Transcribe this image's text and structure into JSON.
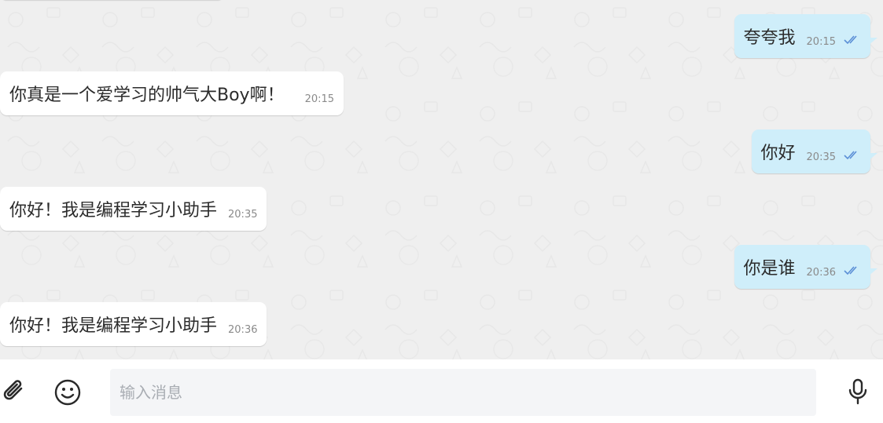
{
  "messages": [
    {
      "direction": "out",
      "text": "夸夸我",
      "time": "20:15",
      "status": "read"
    },
    {
      "direction": "in",
      "text": "你真是一个爱学习的帅气大Boy啊！",
      "time": "20:15"
    },
    {
      "direction": "out",
      "text": "你好",
      "time": "20:35",
      "status": "read"
    },
    {
      "direction": "in",
      "text": "你好！我是编程学习小助手",
      "time": "20:35"
    },
    {
      "direction": "out",
      "text": "你是谁",
      "time": "20:36",
      "status": "read"
    },
    {
      "direction": "in",
      "text": "你好！我是编程学习小助手",
      "time": "20:36"
    }
  ],
  "composer": {
    "placeholder": "输入消息",
    "attach_icon": "paperclip-icon",
    "emoji_icon": "smiley-icon",
    "mic_icon": "microphone-icon"
  },
  "colors": {
    "chat_background": "#efefef",
    "incoming_bubble": "#ffffff",
    "outgoing_bubble": "#cfeefa",
    "read_ticks": "#5b8fd6"
  }
}
